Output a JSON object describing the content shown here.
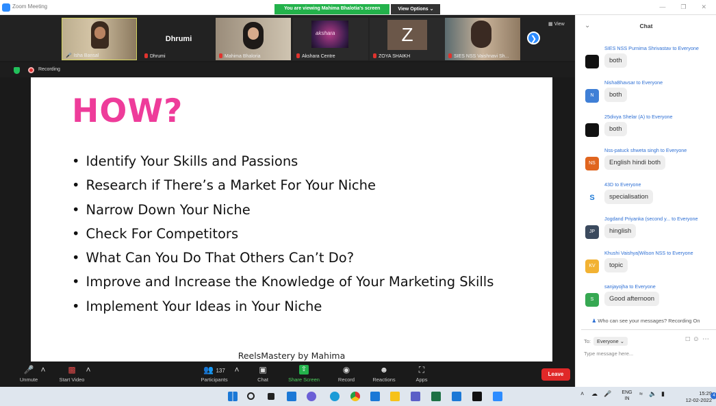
{
  "window": {
    "title": "Zoom Meeting",
    "viewing_banner": "You are viewing Mahima Bhalotia's screen",
    "view_options": "View Options ⌄",
    "view_label": "View"
  },
  "participants_strip": [
    {
      "name": "Isha Bansal",
      "muted": false
    },
    {
      "name": "Dhrumi",
      "muted": true,
      "display_text": "Dhrumi"
    },
    {
      "name": "Mahima Bhaloria",
      "muted": true
    },
    {
      "name": "Akshara Centre",
      "muted": true
    },
    {
      "name": "ZOYA SHAIKH",
      "muted": true,
      "initial": "Z"
    },
    {
      "name": "SIES NSS Vaishnavi Sh...",
      "muted": true
    }
  ],
  "recording": {
    "label": "Recording"
  },
  "slide": {
    "title": "HOW?",
    "bullets": [
      "Identify Your Skills and Passions",
      "Research if There’s a Market For Your Niche",
      "Narrow Down Your Niche",
      "Check For Competitors",
      "What Can You Do That Others Can’t Do?",
      "Improve and Increase the Knowledge of Your Marketing Skills",
      "Implement Your Ideas in Your Niche"
    ],
    "footer": "ReelsMastery by Mahima"
  },
  "toolbar": {
    "unmute": "Unmute",
    "start_video": "Start Video",
    "participants": "Participants",
    "participant_count": "137",
    "chat": "Chat",
    "share_screen": "Share Screen",
    "record": "Record",
    "reactions": "Reactions",
    "apps": "Apps",
    "leave": "Leave"
  },
  "chat": {
    "title": "Chat",
    "messages": [
      {
        "sender": "SIES NSS Purnima Shrivastav",
        "to": "to Everyone",
        "text": "both",
        "avatar": "",
        "color": "#111111"
      },
      {
        "sender": "NishaBhavsar",
        "to": "to Everyone",
        "text": "both",
        "avatar": "N",
        "color": "#3f7fd6"
      },
      {
        "sender": "25divya Shelar (A)",
        "to": "to Everyone",
        "text": "both",
        "avatar": "",
        "color": "#111111"
      },
      {
        "sender": "Nss-patuck shweta singh",
        "to": "to Everyone",
        "text": "English hindi both",
        "avatar": "NS",
        "color": "#e0651f"
      },
      {
        "sender": "43D",
        "to": "to Everyone",
        "text": "specialisation",
        "avatar": "S",
        "color": "#ffffff"
      },
      {
        "sender": "Jogdand Priyanka (second y...",
        "to": "to Everyone",
        "text": "hinglish",
        "avatar": "JP",
        "color": "#3b4a5e"
      },
      {
        "sender": "Khushi Vaishya|Wilson NSS",
        "to": "to Everyone",
        "text": "topic",
        "avatar": "KV",
        "color": "#f2b233"
      },
      {
        "sender": "sanjayojha",
        "to": "to Everyone",
        "text": "Good afternoon",
        "avatar": "S",
        "color": "#36a852"
      }
    ],
    "who_can_see": "Who can see your messages? Recording On",
    "to_label": "To:",
    "to_value": "Everyone ⌄",
    "placeholder": "Type message here..."
  },
  "taskbar": {
    "lang_line1": "ENG",
    "lang_line2": "IN",
    "time": "15:29",
    "date": "12-02-2022",
    "notifications": "4"
  }
}
